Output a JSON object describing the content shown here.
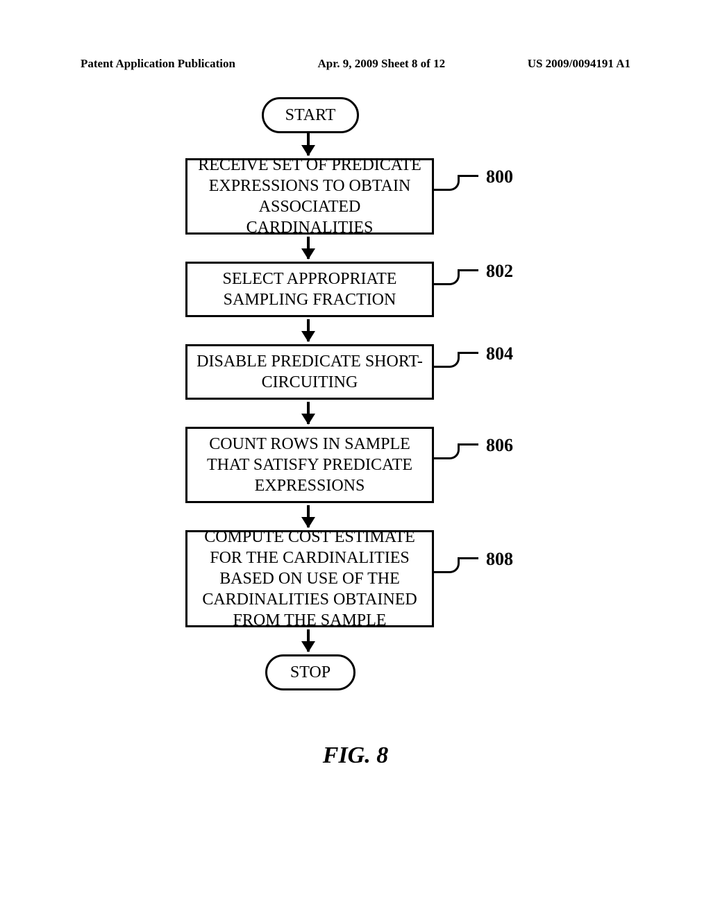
{
  "header": {
    "left": "Patent Application Publication",
    "center": "Apr. 9, 2009   Sheet 8 of 12",
    "right": "US 2009/0094191 A1"
  },
  "flowchart": {
    "start": "START",
    "stop": "STOP",
    "steps": [
      {
        "ref": "800",
        "text": "RECEIVE SET OF PREDICATE EXPRESSIONS TO OBTAIN ASSOCIATED CARDINALITIES"
      },
      {
        "ref": "802",
        "text": "SELECT APPROPRIATE SAMPLING FRACTION"
      },
      {
        "ref": "804",
        "text": "DISABLE PREDICATE SHORT-CIRCUITING"
      },
      {
        "ref": "806",
        "text": "COUNT ROWS IN SAMPLE THAT SATISFY PREDICATE EXPRESSIONS"
      },
      {
        "ref": "808",
        "text": "COMPUTE COST ESTIMATE FOR THE CARDINALITIES BASED ON USE OF THE CARDINALITIES OBTAINED FROM THE SAMPLE"
      }
    ]
  },
  "figure_caption": "FIG. 8"
}
